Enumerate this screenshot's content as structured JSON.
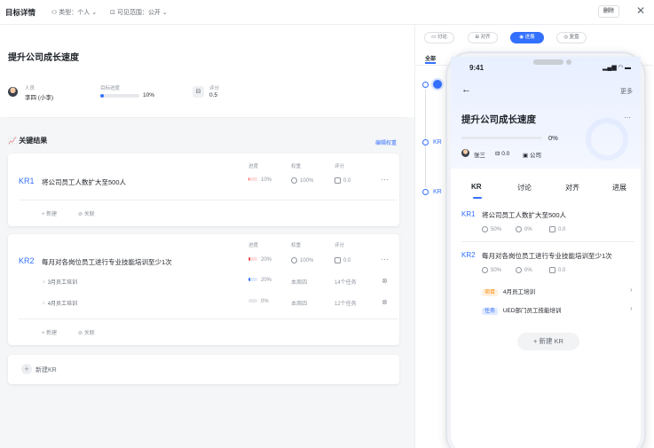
{
  "header": {
    "title": "目标详情",
    "type_label": "类型：个人",
    "visibility_label": "可见范围：公开",
    "delete_label": "删除",
    "close_icon": "close-icon"
  },
  "objective": {
    "title": "提升公司成长速度",
    "owner_label": "人员",
    "owner_name": "李四 (小李)",
    "progress_label": "目标进度",
    "progress_value": "10%",
    "progress_fraction": 0.1,
    "score_label": "评分",
    "score_value": "0.5"
  },
  "key_results": {
    "section_title": "关键结果",
    "edit_weight_label": "编辑权重",
    "columns": {
      "progress": "进度",
      "weight": "权重",
      "score": "评分"
    },
    "add_label": "新建",
    "link_label": "关联",
    "new_kr_label": "新建KR",
    "items": [
      {
        "tag": "KR1",
        "title": "将公司员工人数扩大至500人",
        "progress": "10%",
        "progress_fraction": 0.1,
        "weight": "100%",
        "score": "0.0"
      },
      {
        "tag": "KR2",
        "title": "每月对各岗位员工进行专业技能培训至少1次",
        "progress": "20%",
        "progress_fraction": 0.2,
        "weight": "100%",
        "score": "0.0",
        "tasks": [
          {
            "name": "3月员工培训",
            "progress": "20%",
            "progress_fraction": 0.2,
            "period": "本周四",
            "count": "14个任务"
          },
          {
            "name": "4月员工培训",
            "progress": "0%",
            "progress_fraction": 0,
            "period": "本周四",
            "count": "12个任务"
          }
        ]
      }
    ]
  },
  "right_panel": {
    "tabs": [
      "讨论",
      "对齐",
      "进展",
      "复盘"
    ],
    "active_tab": "进展",
    "sub_tab": "全部",
    "timeline_labels": [
      "KR",
      "KR"
    ]
  },
  "phone": {
    "time": "9:41",
    "more_label": "更多",
    "title": "提升公司成长速度",
    "progress": "0%",
    "owner": "张三",
    "score": "0.0",
    "org": "公司",
    "tabs": [
      "KR",
      "讨论",
      "对齐",
      "进展"
    ],
    "krs": [
      {
        "tag": "KR1",
        "title": "将公司员工人数扩大至500人",
        "weight": "50%",
        "progress": "0%",
        "score": "0.0"
      },
      {
        "tag": "KR2",
        "title": "每月对各岗位员工进行专业技能培训至少1次",
        "weight": "50%",
        "progress": "0%",
        "score": "0.0"
      }
    ],
    "linked": [
      {
        "badge": "项目",
        "name": "4月员工培训",
        "color": "#ff8800"
      },
      {
        "badge": "任务",
        "name": "UED部门员工技能培训",
        "color": "#3370ff"
      }
    ],
    "new_kr_label": "新建 KR"
  },
  "colors": {
    "accent": "#3370ff",
    "danger": "#f54a45"
  }
}
